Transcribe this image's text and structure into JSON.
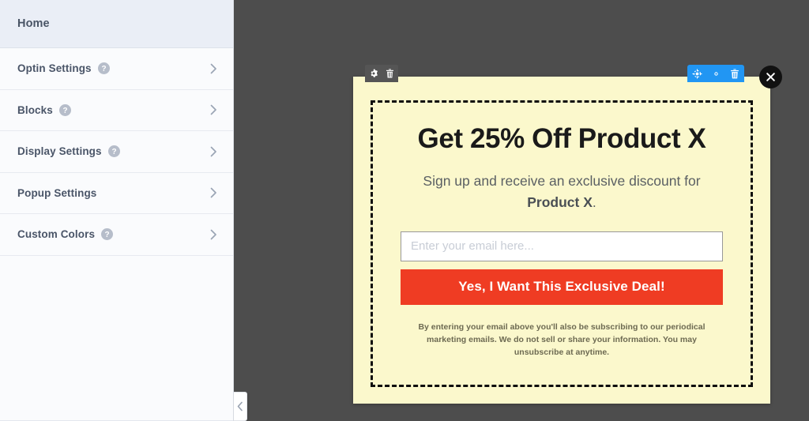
{
  "sidebar": {
    "header": {
      "title": "Home"
    },
    "items": [
      {
        "label": "Optin Settings",
        "help": true,
        "help_icon": "question-mark-circle-icon",
        "chevron_icon": "chevron-right-icon"
      },
      {
        "label": "Blocks",
        "help": true,
        "help_icon": "question-mark-circle-icon",
        "chevron_icon": "chevron-right-icon"
      },
      {
        "label": "Display Settings",
        "help": true,
        "help_icon": "question-mark-circle-icon",
        "chevron_icon": "chevron-right-icon"
      },
      {
        "label": "Popup Settings",
        "help": false,
        "help_icon": "",
        "chevron_icon": "chevron-right-icon"
      },
      {
        "label": "Custom Colors",
        "help": true,
        "help_icon": "question-mark-circle-icon",
        "chevron_icon": "chevron-right-icon"
      }
    ],
    "collapse_handle": {
      "icon": "chevron-left-icon"
    }
  },
  "canvas": {
    "background_color": "#4d4d4d"
  },
  "popup": {
    "background_color": "#fbf8cc",
    "headline": "Get 25% Off Product X",
    "subheadline_text": "Sign up and receive an exclusive discount for ",
    "subheadline_bold": "Product X",
    "subheadline_tail": ".",
    "email": {
      "placeholder": "Enter your email here...",
      "value": ""
    },
    "cta": {
      "label": "Yes, I Want This Exclusive Deal!",
      "color": "#ef3c23"
    },
    "fine_print": "By entering your email above you'll also be subscribing to our periodical marketing emails. We do not sell or share your information. You may unsubscribe at anytime.",
    "close_icon": "close-x-icon",
    "toolbar_popup": {
      "color": "#555555",
      "buttons": [
        {
          "icon": "gear-icon",
          "name": "popup-settings"
        },
        {
          "icon": "trash-icon",
          "name": "popup-delete"
        }
      ]
    },
    "toolbar_block": {
      "color": "#2196f3",
      "buttons": [
        {
          "icon": "move-icon",
          "name": "block-move"
        },
        {
          "icon": "gear-icon",
          "name": "block-settings"
        },
        {
          "icon": "trash-icon",
          "name": "block-delete"
        }
      ]
    }
  }
}
